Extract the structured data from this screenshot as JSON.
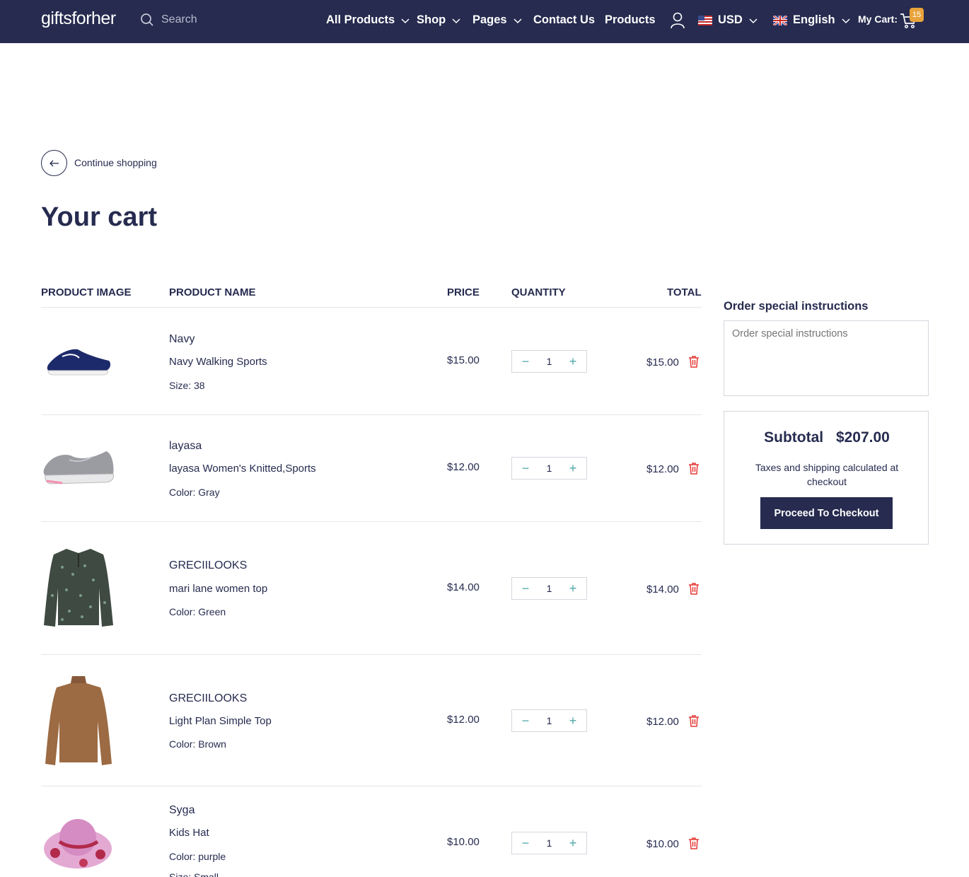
{
  "header": {
    "logo": "giftsforher",
    "search_placeholder": "Search",
    "nav": [
      {
        "label": "All Products",
        "has_dropdown": true
      },
      {
        "label": "Shop",
        "has_dropdown": true
      },
      {
        "label": "Pages",
        "has_dropdown": true
      },
      {
        "label": "Contact Us",
        "has_dropdown": false
      },
      {
        "label": "Products",
        "has_dropdown": false
      }
    ],
    "currency": "USD",
    "language": "English",
    "cart_label": "My Cart:",
    "cart_count": "15"
  },
  "continue_shopping": "Continue shopping",
  "page_title": "Your cart",
  "table_headers": {
    "image": "PRODUCT IMAGE",
    "name": "PRODUCT NAME",
    "price": "PRICE",
    "quantity": "QUANTITY",
    "total": "TOTAL"
  },
  "items": [
    {
      "vendor": "Navy",
      "name": "Navy Walking Sports",
      "variant_label": "Size:",
      "variant_value": "38",
      "price": "$15.00",
      "quantity": "1",
      "total": "$15.00",
      "image": "navy-sneaker"
    },
    {
      "vendor": "layasa",
      "name": "layasa Women's Knitted,Sports",
      "variant_label": "Color:",
      "variant_value": "Gray",
      "price": "$12.00",
      "quantity": "1",
      "total": "$12.00",
      "image": "gray-sneaker"
    },
    {
      "vendor": "GRECIILOOKS",
      "name": "mari lane women top",
      "variant_label": "Color:",
      "variant_value": "Green",
      "price": "$14.00",
      "quantity": "1",
      "total": "$14.00",
      "image": "green-floral-top"
    },
    {
      "vendor": "GRECIILOOKS",
      "name": "Light Plan Simple Top",
      "variant_label": "Color:",
      "variant_value": "Brown",
      "price": "$12.00",
      "quantity": "1",
      "total": "$12.00",
      "image": "brown-top"
    },
    {
      "vendor": "Syga",
      "name": "Kids Hat",
      "variant_label": "Color:",
      "variant_value": "purple",
      "extra_label": "Size:",
      "extra_value": "Small",
      "price": "$10.00",
      "quantity": "1",
      "total": "$10.00",
      "image": "pink-hat"
    }
  ],
  "sidebar": {
    "instructions_title": "Order special instructions",
    "instructions_placeholder": "Order special instructions",
    "subtotal_label": "Subtotal",
    "subtotal_value": "$207.00",
    "tax_note": "Taxes and shipping calculated at checkout",
    "checkout_label": "Proceed To Checkout"
  },
  "colors": {
    "brand_navy": "#262b4f",
    "badge": "#e8a33b",
    "qty_accent": "#4fa7a9",
    "delete_red": "#e53935"
  }
}
